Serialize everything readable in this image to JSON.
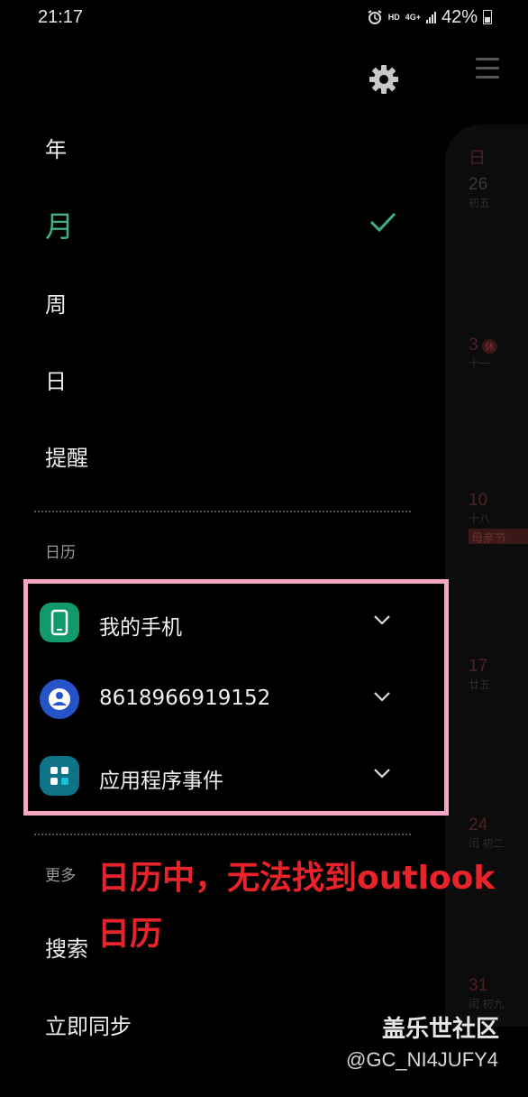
{
  "status_bar": {
    "time": "21:17",
    "network_hd": "HD",
    "network_4g": "4G+",
    "battery": "42%"
  },
  "views": {
    "year": "年",
    "month": "月",
    "week": "周",
    "day": "日",
    "reminders": "提醒"
  },
  "calendars_section": {
    "label": "日历",
    "items": [
      {
        "name": "我的手机",
        "icon": "phone-icon",
        "color": "#129a6a"
      },
      {
        "name": "8618966919152",
        "icon": "account-icon",
        "color": "#2553c8"
      },
      {
        "name": "应用程序事件",
        "icon": "apps-icon",
        "color": "#0e7386"
      }
    ]
  },
  "more_section": {
    "label": "更多",
    "search": "搜索",
    "sync": "立即同步"
  },
  "annotation": {
    "line1": "日历中，无法找到outlook",
    "line2": "日历"
  },
  "calendar_strip": {
    "row1": {
      "date": "26",
      "sub": "初五"
    },
    "row2": {
      "date": "3",
      "badge": "休",
      "sub": "十一"
    },
    "row3": {
      "date": "10",
      "sub": "十八",
      "holiday": "母亲节"
    },
    "row4": {
      "date": "17",
      "sub": "廿五"
    },
    "row5": {
      "date": "24",
      "sub": "闰 初二"
    },
    "row6": {
      "date": "31",
      "sub": "闰 初九"
    }
  },
  "watermark": {
    "site": "盖乐世社区",
    "user": "@GC_NI4JUFY4"
  },
  "colors": {
    "accent": "#3fb08f",
    "highlight_border": "#f3a7c4",
    "note_red": "#e8232a"
  }
}
